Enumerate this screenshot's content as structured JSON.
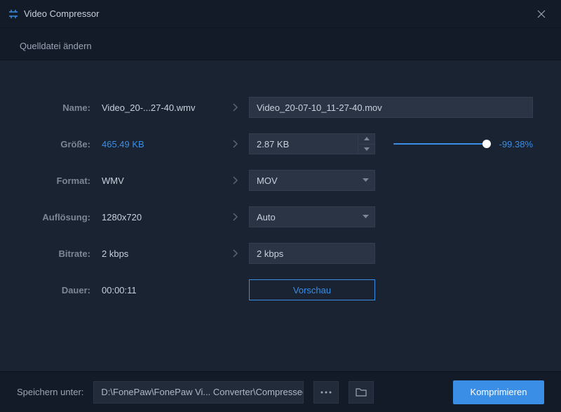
{
  "titlebar": {
    "title": "Video Compressor"
  },
  "subtitle": "Quelldatei ändern",
  "rows": {
    "name": {
      "label": "Name:",
      "orig": "Video_20-...27-40.wmv",
      "target": "Video_20-07-10_11-27-40.mov"
    },
    "size": {
      "label": "Größe:",
      "orig": "465.49 KB",
      "target": "2.87 KB",
      "percent": "-99.38%"
    },
    "format": {
      "label": "Format:",
      "orig": "WMV",
      "target": "MOV"
    },
    "resolution": {
      "label": "Auflösung:",
      "orig": "1280x720",
      "target": "Auto"
    },
    "bitrate": {
      "label": "Bitrate:",
      "orig": "2 kbps",
      "target": "2 kbps"
    },
    "duration": {
      "label": "Dauer:",
      "orig": "00:00:11"
    }
  },
  "preview_label": "Vorschau",
  "footer": {
    "save_label": "Speichern unter:",
    "path": "D:\\FonePaw\\FonePaw Vi... Converter\\Compressed",
    "compress_label": "Komprimieren"
  }
}
